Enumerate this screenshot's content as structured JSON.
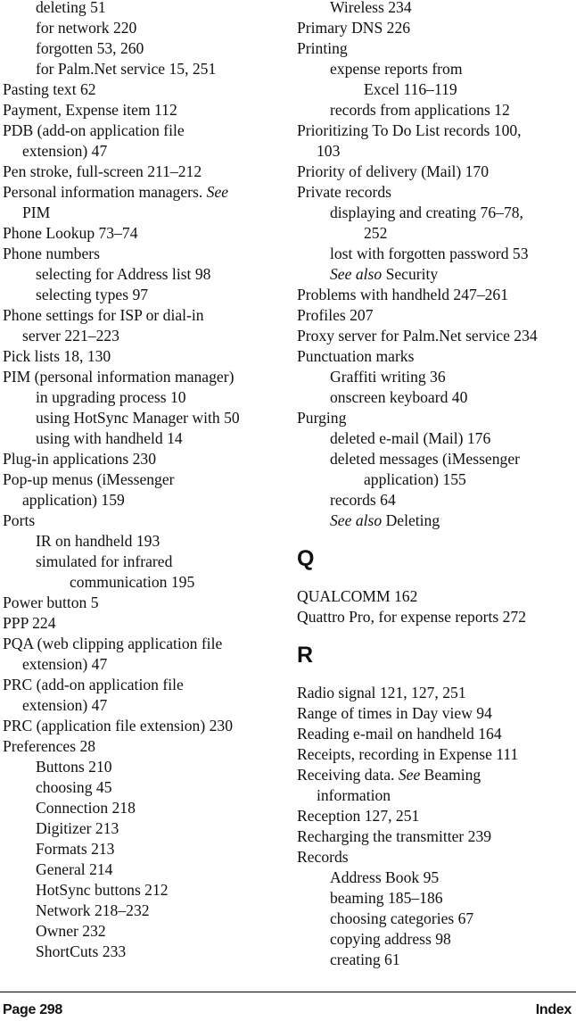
{
  "index": {
    "left_column": [
      {
        "level": 2,
        "text": "deleting 51"
      },
      {
        "level": 2,
        "text": "for network 220"
      },
      {
        "level": 2,
        "text": "forgotten 53, 260"
      },
      {
        "level": 2,
        "text": "for Palm.Net service 15, 251"
      },
      {
        "level": 0,
        "text": "Pasting text 62"
      },
      {
        "level": 0,
        "text": "Payment, Expense item 112"
      },
      {
        "level": 0,
        "text": "PDB (add-on application file"
      },
      {
        "level": 1,
        "text": "extension) 47"
      },
      {
        "level": 0,
        "text": "Pen stroke, full-screen 211–212"
      },
      {
        "level": 0,
        "text": "Personal information managers.",
        "see": "See",
        "after": ""
      },
      {
        "level": 1,
        "text": "PIM"
      },
      {
        "level": 0,
        "text": "Phone Lookup 73–74"
      },
      {
        "level": 0,
        "text": "Phone numbers"
      },
      {
        "level": 2,
        "text": "selecting for Address list 98"
      },
      {
        "level": 2,
        "text": "selecting types 97"
      },
      {
        "level": 0,
        "text": "Phone settings for ISP or dial-in"
      },
      {
        "level": 1,
        "text": "server 221–223"
      },
      {
        "level": 0,
        "text": "Pick lists 18, 130"
      },
      {
        "level": 0,
        "text": "PIM (personal information manager)"
      },
      {
        "level": 2,
        "text": "in upgrading process 10"
      },
      {
        "level": 2,
        "text": "using HotSync Manager with 50"
      },
      {
        "level": 2,
        "text": "using with handheld 14"
      },
      {
        "level": 0,
        "text": "Plug-in applications 230"
      },
      {
        "level": 0,
        "text": "Pop-up menus (iMessenger"
      },
      {
        "level": 1,
        "text": "application) 159"
      },
      {
        "level": 0,
        "text": "Ports"
      },
      {
        "level": 2,
        "text": "IR on handheld 193"
      },
      {
        "level": 2,
        "text": "simulated for infrared"
      },
      {
        "level": 3,
        "text": "communication 195"
      },
      {
        "level": 0,
        "text": "Power button 5"
      },
      {
        "level": 0,
        "text": "PPP 224"
      },
      {
        "level": 0,
        "text": "PQA (web clipping application file"
      },
      {
        "level": 1,
        "text": "extension) 47"
      },
      {
        "level": 0,
        "text": "PRC (add-on application file"
      },
      {
        "level": 1,
        "text": "extension) 47"
      },
      {
        "level": 0,
        "text": "PRC (application file extension) 230"
      },
      {
        "level": 0,
        "text": "Preferences 28"
      },
      {
        "level": 2,
        "text": "Buttons 210"
      },
      {
        "level": 2,
        "text": "choosing 45"
      },
      {
        "level": 2,
        "text": "Connection 218"
      },
      {
        "level": 2,
        "text": "Digitizer 213"
      },
      {
        "level": 2,
        "text": "Formats 213"
      },
      {
        "level": 2,
        "text": "General 214"
      },
      {
        "level": 2,
        "text": "HotSync buttons 212"
      },
      {
        "level": 2,
        "text": "Network 218–232"
      },
      {
        "level": 2,
        "text": "Owner 232"
      },
      {
        "level": 2,
        "text": "ShortCuts 233"
      }
    ],
    "right_column": [
      {
        "level": 2,
        "text": "Wireless 234"
      },
      {
        "level": 0,
        "text": "Primary DNS 226"
      },
      {
        "level": 0,
        "text": "Printing"
      },
      {
        "level": 2,
        "text": "expense reports from"
      },
      {
        "level": 3,
        "text": "Excel 116–119"
      },
      {
        "level": 2,
        "text": "records from applications 12"
      },
      {
        "level": 0,
        "text": "Prioritizing To Do List records 100,"
      },
      {
        "level": 1,
        "text": "103"
      },
      {
        "level": 0,
        "text": "Priority of delivery (Mail) 170"
      },
      {
        "level": 0,
        "text": "Private records"
      },
      {
        "level": 2,
        "text": "displaying and creating 76–78,"
      },
      {
        "level": 3,
        "text": "252"
      },
      {
        "level": 2,
        "text": "lost with forgotten password 53"
      },
      {
        "level": 2,
        "text": "",
        "see": "See also",
        "after": "Security"
      },
      {
        "level": 0,
        "text": "Problems with handheld 247–261"
      },
      {
        "level": 0,
        "text": "Profiles 207"
      },
      {
        "level": 0,
        "text": "Proxy server for Palm.Net service 234"
      },
      {
        "level": 0,
        "text": "Punctuation marks"
      },
      {
        "level": 2,
        "text": "Graffiti writing 36"
      },
      {
        "level": 2,
        "text": "onscreen keyboard 40"
      },
      {
        "level": 0,
        "text": "Purging"
      },
      {
        "level": 2,
        "text": "deleted e-mail (Mail) 176"
      },
      {
        "level": 2,
        "text": "deleted messages (iMessenger"
      },
      {
        "level": 3,
        "text": "application) 155"
      },
      {
        "level": 2,
        "text": "records 64"
      },
      {
        "level": 2,
        "text": "",
        "see": "See also",
        "after": "Deleting"
      },
      {
        "letter": "Q"
      },
      {
        "level": 0,
        "text": "QUALCOMM 162"
      },
      {
        "level": 0,
        "text": "Quattro Pro, for expense reports 272"
      },
      {
        "letter": "R"
      },
      {
        "level": 0,
        "text": "Radio signal 121, 127, 251"
      },
      {
        "level": 0,
        "text": "Range of times in Day view 94"
      },
      {
        "level": 0,
        "text": "Reading e-mail on handheld 164"
      },
      {
        "level": 0,
        "text": "Receipts, recording in Expense 111"
      },
      {
        "level": 0,
        "text": "Receiving data.",
        "see": "See",
        "after": "Beaming"
      },
      {
        "level": 1,
        "text": "information"
      },
      {
        "level": 0,
        "text": "Reception 127, 251"
      },
      {
        "level": 0,
        "text": "Recharging the transmitter 239"
      },
      {
        "level": 0,
        "text": "Records"
      },
      {
        "level": 2,
        "text": "Address Book 95"
      },
      {
        "level": 2,
        "text": "beaming 185–186"
      },
      {
        "level": 2,
        "text": "choosing categories 67"
      },
      {
        "level": 2,
        "text": "copying address 98"
      },
      {
        "level": 2,
        "text": "creating 61"
      }
    ]
  },
  "footer": {
    "page_label": "Page 298",
    "section_label": "Index"
  }
}
